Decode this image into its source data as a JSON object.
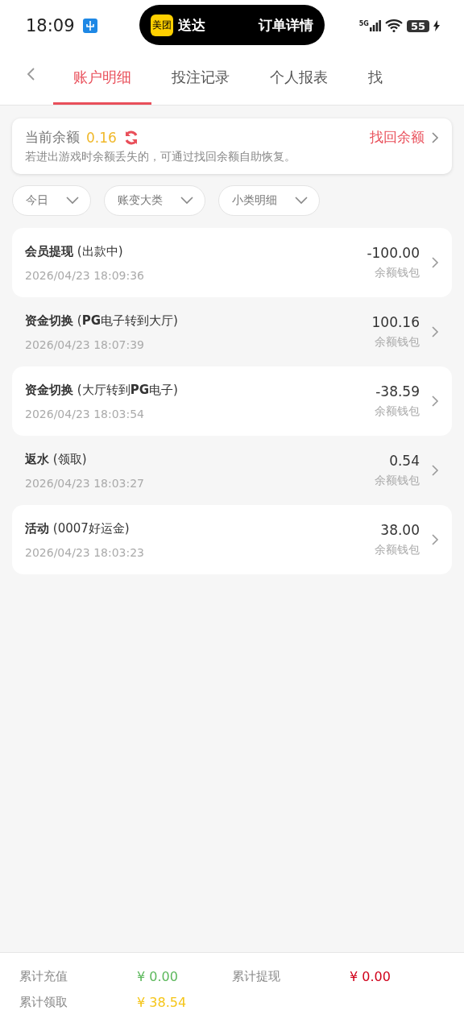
{
  "status_bar": {
    "time": "18:09",
    "island": {
      "badge": "美团",
      "status": "送达",
      "action": "订单详情"
    },
    "network": "5G",
    "battery": "55"
  },
  "tabs": [
    {
      "label": "账户明细",
      "selected": true
    },
    {
      "label": "投注记录",
      "selected": false
    },
    {
      "label": "个人报表",
      "selected": false
    },
    {
      "label": "找",
      "selected": false
    }
  ],
  "balance": {
    "label": "当前余额",
    "amount": "0.16",
    "link": "找回余额",
    "hint": "若进出游戏时余额丢失的，可通过找回余额自助恢复。"
  },
  "filters": [
    "今日",
    "账变大类",
    "小类明细"
  ],
  "records": [
    {
      "title": "会员提现",
      "detail": "(出款中)",
      "time": "2026/04/23 18:09:36",
      "amount": "-100.00",
      "wallet": "余额钱包"
    },
    {
      "title": "资金切换",
      "detail": "(**PG**电子转到大厅)",
      "time": "2026/04/23 18:07:39",
      "amount": "100.16",
      "wallet": "余额钱包"
    },
    {
      "title": "资金切换",
      "detail": "(大厅转到**PG**电子)",
      "time": "2026/04/23 18:03:54",
      "amount": "-38.59",
      "wallet": "余额钱包"
    },
    {
      "title": "返水",
      "detail": "(领取)",
      "time": "2026/04/23 18:03:27",
      "amount": "0.54",
      "wallet": "余额钱包"
    },
    {
      "title": "活动",
      "detail": "(0007好运金)",
      "time": "2026/04/23 18:03:23",
      "amount": "38.00",
      "wallet": "余额钱包"
    }
  ],
  "totals": [
    {
      "label": "累计充值",
      "value": "¥ 0.00",
      "color": "#5cb85c"
    },
    {
      "label": "累计提现",
      "value": "¥ 0.00",
      "color": "#d0021b"
    },
    {
      "label": "累计领取",
      "value": "¥ 38.54",
      "color": "#f5c518"
    }
  ]
}
